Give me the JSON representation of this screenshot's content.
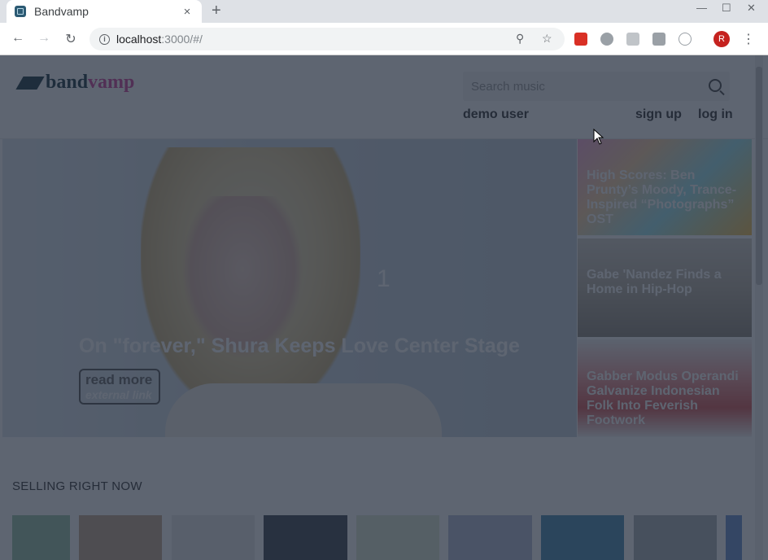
{
  "browser": {
    "tab_title": "Bandvamp",
    "tab_close": "×",
    "new_tab": "+",
    "url_host": "localhost",
    "url_rest": ":3000/#/",
    "avatar_letter": "R"
  },
  "site": {
    "logo_band": "band",
    "logo_vamp": "vamp",
    "search_placeholder": "Search music",
    "nav": {
      "demo_user": "demo user",
      "sign_up": "sign up",
      "log_in": "log in"
    }
  },
  "hero": {
    "slide_number": "1",
    "title": "On \"forever,\" Shura Keeps Love Center Stage",
    "read_more": "read more",
    "external_link": "external link"
  },
  "side_stories": [
    {
      "title": "High Scores: Ben Prunty’s Moody, Trance-Inspired “Photographs” OST"
    },
    {
      "title": "Gabe 'Nandez Finds a Home in Hip-Hop"
    },
    {
      "title": "Gabber Modus Operandi Galvanize Indonesian Folk Into Feverish Footwork"
    }
  ],
  "section": {
    "title": "SELLING RIGHT NOW"
  },
  "colors": {
    "brand_dark": "#1a3640",
    "brand_pink": "#d0409a",
    "overlay": "rgba(32,42,58,0.72)"
  },
  "albums": [
    {
      "name": "album-cover-1",
      "color": "#9bc7a8"
    },
    {
      "name": "album-cover-2",
      "color": "#c7a88e"
    },
    {
      "name": "album-cover-3",
      "color": "#e8e8e8"
    },
    {
      "name": "album-cover-4",
      "color": "#3e4650"
    },
    {
      "name": "album-cover-5",
      "color": "#dfe8d2"
    },
    {
      "name": "album-cover-6",
      "color": "#b7bfd6"
    },
    {
      "name": "album-cover-7",
      "color": "#4a8bb3"
    },
    {
      "name": "album-cover-8",
      "color": "#aeb3b8"
    },
    {
      "name": "album-cover-9",
      "color": "#6a8fd0"
    }
  ]
}
